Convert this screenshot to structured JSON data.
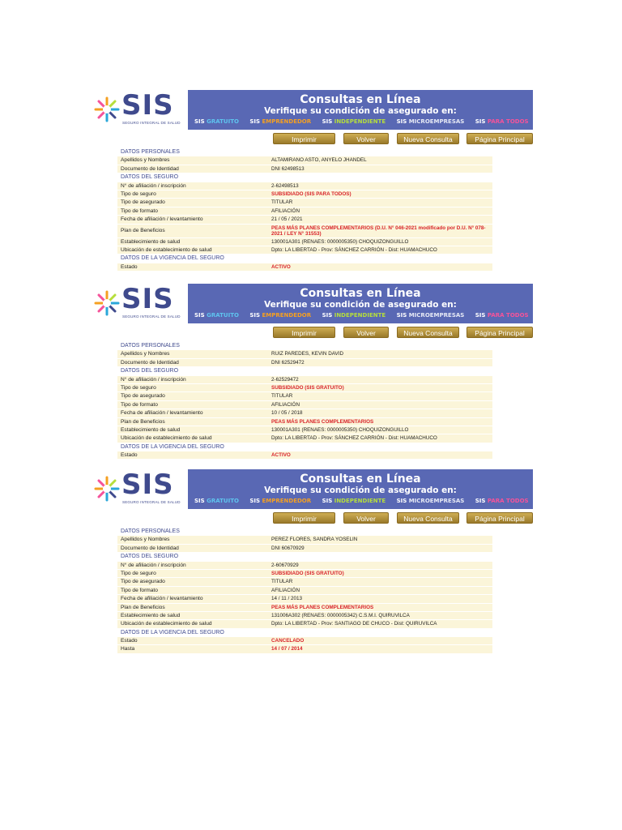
{
  "colors": {
    "banner": "#5968b4",
    "accent_red": "#d8232a",
    "button_gold": "#b8963d",
    "row_bg": "#fbf5d9"
  },
  "header": {
    "logo_text": "SIS",
    "logo_subtitle": "SEGURO INTEGRAL DE SALUD",
    "title": "Consultas en Línea",
    "subtitle": "Verifique su condición de asegurado en:",
    "programs": [
      {
        "prefix": "SIS",
        "name": "GRATUITO"
      },
      {
        "prefix": "SIS",
        "name": "EMPRENDEDOR"
      },
      {
        "prefix": "SIS",
        "name": "INDEPENDIENTE"
      },
      {
        "prefix": "SIS",
        "name": "MICROEMPRESAS"
      },
      {
        "prefix": "SIS",
        "name": "PARA TODOS"
      }
    ]
  },
  "buttons": {
    "print": "Imprimir",
    "back": "Volver",
    "new_query": "Nueva Consulta",
    "home": "Página Principal"
  },
  "labels": {
    "sec_personal": "DATOS PERSONALES",
    "names": "Apellidos y Nombres",
    "document": "Documento de Identidad",
    "sec_insurance": "DATOS DEL SEGURO",
    "affiliation_no": "N° de afiliación / inscripción",
    "insurance_type": "Tipo de seguro",
    "insured_type": "Tipo de asegurado",
    "format_type": "Tipo de formato",
    "affiliation_date": "Fecha de afiliación / levantamiento",
    "benefit_plan": "Plan de Beneficios",
    "health_facility": "Establecimiento de salud",
    "facility_location": "Ubicación de establecimiento de salud",
    "sec_validity": "DATOS DE LA VIGENCIA DEL SEGURO",
    "status": "Estado",
    "until": "Hasta"
  },
  "records": [
    {
      "names": "ALTAMIRANO ASTO, ANYELO JHANDEL",
      "document": "DNI 62498513",
      "affiliation_no": "2-62498513",
      "insurance_type": "SUBSIDIADO (SIS PARA TODOS)",
      "insured_type": "TITULAR",
      "format_type": "AFILIACIÓN",
      "affiliation_date": "21 / 05 / 2021",
      "benefit_plan": "PEAS MÁS PLANES COMPLEMENTARIOS (D.U. N° 046-2021 modificado por D.U. N° 078-2021 / LEY N° 31553)",
      "health_facility": "130001A301 (RENAES: 0000005350) CHOQUIZONGUILLO",
      "facility_location": "Dpto: LA LIBERTAD - Prov: SÁNCHEZ CARRIÓN - Dist: HUAMACHUCO",
      "status": "ACTIVO",
      "until": ""
    },
    {
      "names": "RUIZ PAREDES, KEVIN DAVID",
      "document": "DNI 62529472",
      "affiliation_no": "2-62529472",
      "insurance_type": "SUBSIDIADO (SIS GRATUITO)",
      "insured_type": "TITULAR",
      "format_type": "AFILIACIÓN",
      "affiliation_date": "10 / 05 / 2018",
      "benefit_plan": "PEAS MÁS PLANES COMPLEMENTARIOS",
      "health_facility": "130001A301 (RENAES: 0000005350) CHOQUIZONGUILLO",
      "facility_location": "Dpto: LA LIBERTAD - Prov: SÁNCHEZ CARRIÓN - Dist: HUAMACHUCO",
      "status": "ACTIVO",
      "until": ""
    },
    {
      "names": "PEREZ FLORES, SANDRA YOSELIN",
      "document": "DNI 60670929",
      "affiliation_no": "2-60670929",
      "insurance_type": "SUBSIDIADO (SIS GRATUITO)",
      "insured_type": "TITULAR",
      "format_type": "AFILIACIÓN",
      "affiliation_date": "14 / 11 / 2013",
      "benefit_plan": "PEAS MÁS PLANES COMPLEMENTARIOS",
      "health_facility": "131006A302 (RENAES: 0000005342) C.S.M.I. QUIRUVILCA",
      "facility_location": "Dpto: LA LIBERTAD - Prov: SANTIAGO DE CHUCO - Dist: QUIRUVILCA",
      "status": "CANCELADO",
      "until": "14 / 07 / 2014"
    }
  ]
}
